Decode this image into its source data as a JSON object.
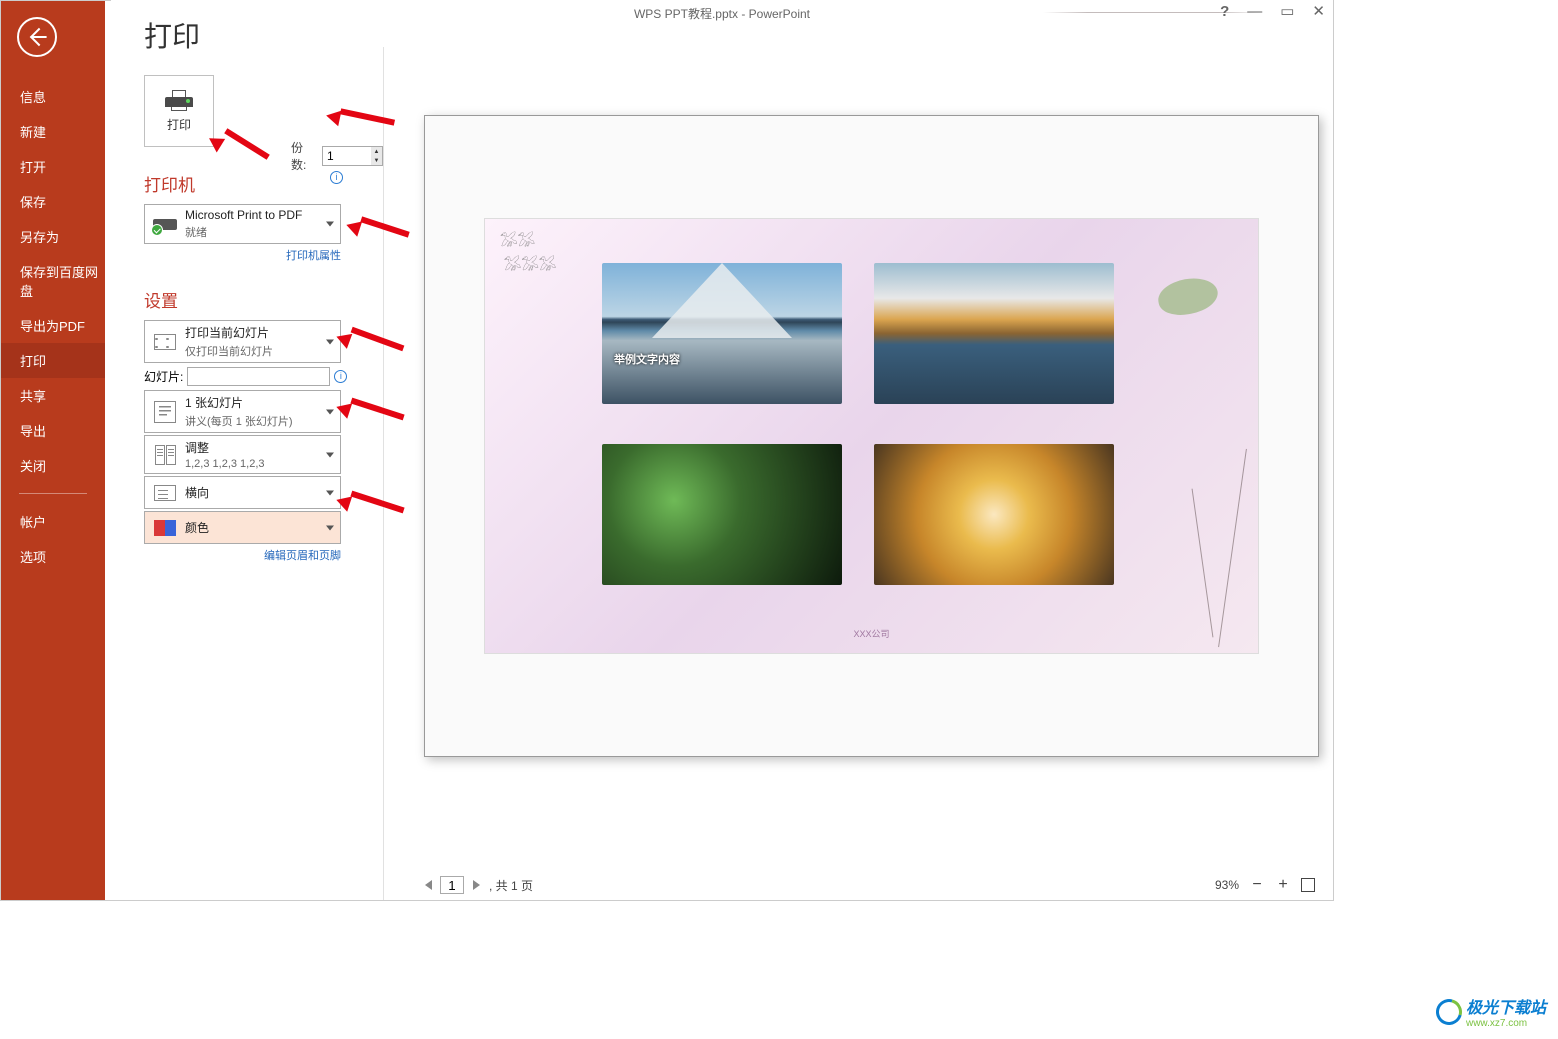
{
  "title": "WPS PPT教程.pptx - PowerPoint",
  "sidebar": {
    "items": [
      "信息",
      "新建",
      "打开",
      "保存",
      "另存为",
      "保存到百度网盘",
      "导出为PDF",
      "打印",
      "共享",
      "导出",
      "关闭"
    ],
    "bottom": [
      "帐户",
      "选项"
    ],
    "active_index": 7
  },
  "page_header": "打印",
  "print_button": {
    "label": "打印"
  },
  "copies": {
    "label": "份数:",
    "value": "1"
  },
  "printer_section": {
    "title": "打印机",
    "selected": {
      "name": "Microsoft Print to PDF",
      "status": "就绪"
    },
    "properties_link": "打印机属性"
  },
  "settings_section": {
    "title": "设置",
    "scope": {
      "line1": "打印当前幻灯片",
      "line2": "仅打印当前幻灯片"
    },
    "slides_label": "幻灯片:",
    "slides_value": "",
    "layout": {
      "line1": "1 张幻灯片",
      "line2": "讲义(每页 1 张幻灯片)"
    },
    "collate": {
      "line1": "调整",
      "line2": "1,2,3    1,2,3    1,2,3"
    },
    "orientation": {
      "line1": "横向"
    },
    "color": {
      "line1": "颜色"
    },
    "edit_header_footer_link": "编辑页眉和页脚"
  },
  "preview": {
    "caption": "举例文字内容",
    "footer": "XXX公司"
  },
  "statusbar": {
    "current_page": "1",
    "page_total_label": ", 共 1 页",
    "zoom": "93%"
  },
  "watermark": {
    "brand": "极光下载站",
    "url": "www.xz7.com"
  }
}
